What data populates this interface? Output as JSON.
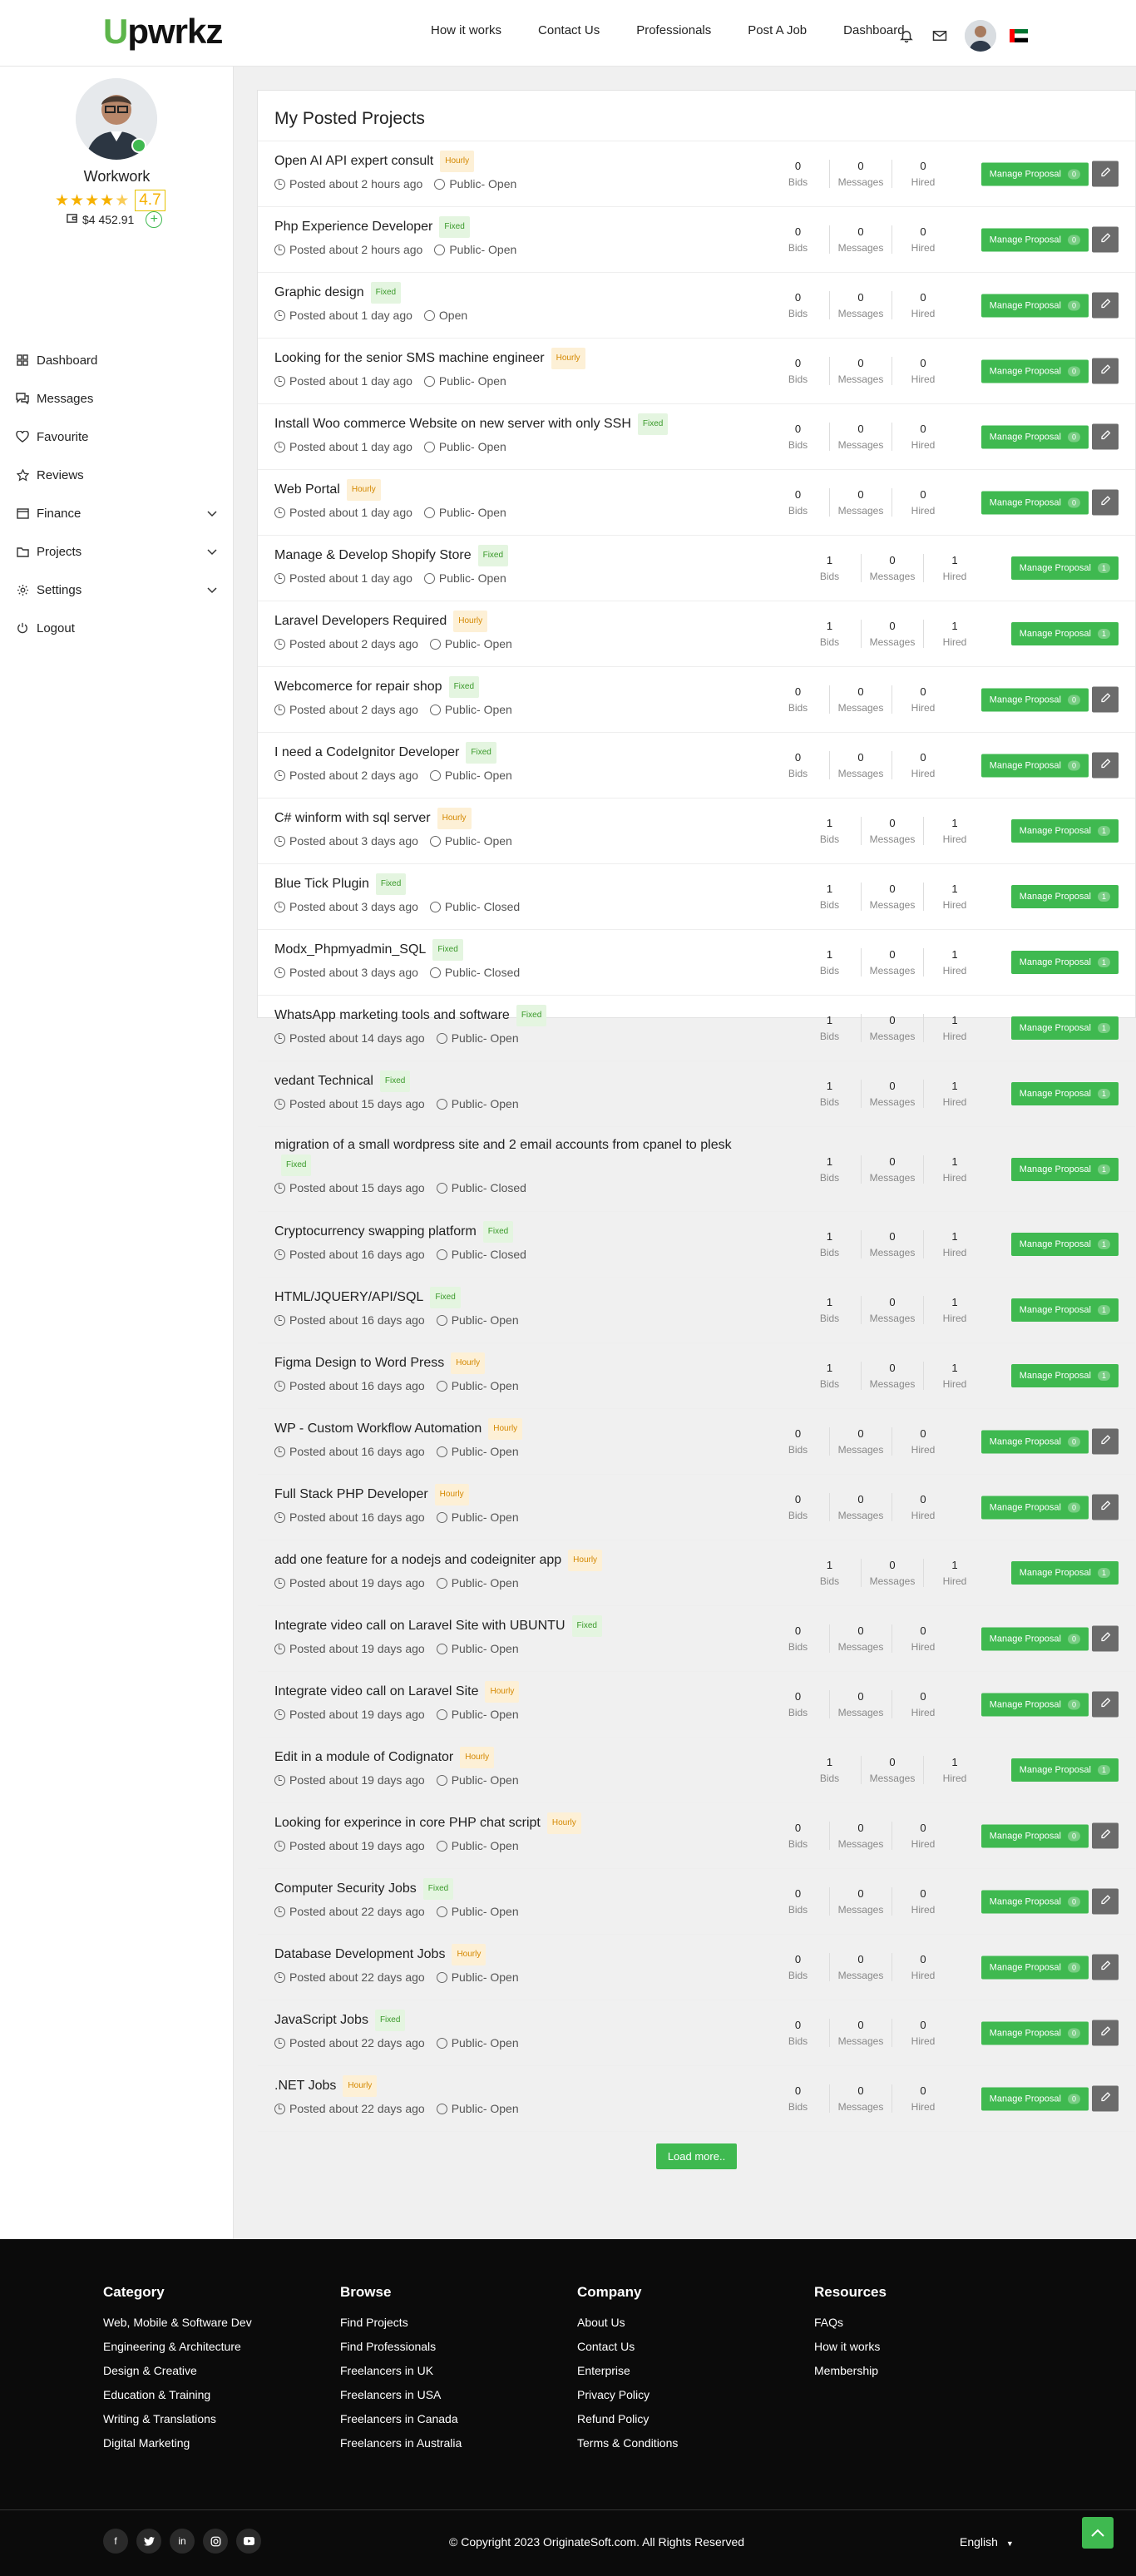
{
  "header": {
    "logo_u": "U",
    "logo_rest": "pwrkz",
    "nav": [
      "How it works",
      "Contact Us",
      "Professionals",
      "Post A Job",
      "Dashboard"
    ]
  },
  "profile": {
    "name": "Workwork",
    "rating": "4.7",
    "stars": 4.5,
    "balance": "$4 452.91"
  },
  "menu": [
    "Dashboard",
    "Messages",
    "Favourite",
    "Reviews",
    "Finance",
    "Projects",
    "Settings",
    "Logout"
  ],
  "card_title": "My Posted Projects",
  "labels": {
    "bids": "Bids",
    "messages": "Messages",
    "hired": "Hired",
    "manage": "Manage Proposal",
    "load_more": "Load more.."
  },
  "projects": [
    {
      "title": "Open AI API expert consult",
      "type": "Hourly",
      "posted": "Posted about 2 hours ago",
      "vis": "Public- Open",
      "bids": 0,
      "messages": 0,
      "hired": 0
    },
    {
      "title": "Php Experience Developer",
      "type": "Fixed",
      "posted": "Posted about 2 hours ago",
      "vis": "Public- Open",
      "bids": 0,
      "messages": 0,
      "hired": 0
    },
    {
      "title": "Graphic design",
      "type": "Fixed",
      "posted": "Posted about 1 day ago",
      "vis": "Open",
      "bids": 0,
      "messages": 0,
      "hired": 0
    },
    {
      "title": "Looking for the senior SMS machine engineer",
      "type": "Hourly",
      "posted": "Posted about 1 day ago",
      "vis": "Public- Open",
      "bids": 0,
      "messages": 0,
      "hired": 0
    },
    {
      "title": "Install Woo commerce Website on new server with only SSH",
      "type": "Fixed",
      "posted": "Posted about 1 day ago",
      "vis": "Public- Open",
      "bids": 0,
      "messages": 0,
      "hired": 0
    },
    {
      "title": "Web Portal",
      "type": "Hourly",
      "posted": "Posted about 1 day ago",
      "vis": "Public- Open",
      "bids": 0,
      "messages": 0,
      "hired": 0
    },
    {
      "title": "Manage & Develop Shopify Store",
      "type": "Fixed",
      "posted": "Posted about 1 day ago",
      "vis": "Public- Open",
      "bids": 1,
      "messages": 0,
      "hired": 1
    },
    {
      "title": "Laravel Developers Required",
      "type": "Hourly",
      "posted": "Posted about 2 days ago",
      "vis": "Public- Open",
      "bids": 1,
      "messages": 0,
      "hired": 1
    },
    {
      "title": "Webcomerce for repair shop",
      "type": "Fixed",
      "posted": "Posted about 2 days ago",
      "vis": "Public- Open",
      "bids": 0,
      "messages": 0,
      "hired": 0
    },
    {
      "title": "I need a CodeIgnitor Developer",
      "type": "Fixed",
      "posted": "Posted about 2 days ago",
      "vis": "Public- Open",
      "bids": 0,
      "messages": 0,
      "hired": 0
    },
    {
      "title": "C# winform with sql server",
      "type": "Hourly",
      "posted": "Posted about 3 days ago",
      "vis": "Public- Open",
      "bids": 1,
      "messages": 0,
      "hired": 1
    },
    {
      "title": "Blue Tick Plugin",
      "type": "Fixed",
      "posted": "Posted about 3 days ago",
      "vis": "Public- Closed",
      "bids": 1,
      "messages": 0,
      "hired": 1
    },
    {
      "title": "Modx_Phpmyadmin_SQL",
      "type": "Fixed",
      "posted": "Posted about 3 days ago",
      "vis": "Public- Closed",
      "bids": 1,
      "messages": 0,
      "hired": 1
    },
    {
      "title": "WhatsApp marketing tools and software",
      "type": "Fixed",
      "posted": "Posted about 14 days ago",
      "vis": "Public- Open",
      "bids": 1,
      "messages": 0,
      "hired": 1
    },
    {
      "title": "vedant Technical",
      "type": "Fixed",
      "posted": "Posted about 15 days ago",
      "vis": "Public- Open",
      "bids": 1,
      "messages": 0,
      "hired": 1
    },
    {
      "title": "migration of a small wordpress site and 2 email accounts from cpanel to plesk",
      "type": "Fixed",
      "posted": "Posted about 15 days ago",
      "vis": "Public- Closed",
      "bids": 1,
      "messages": 0,
      "hired": 1
    },
    {
      "title": "Cryptocurrency swapping platform",
      "type": "Fixed",
      "posted": "Posted about 16 days ago",
      "vis": "Public- Closed",
      "bids": 1,
      "messages": 0,
      "hired": 1
    },
    {
      "title": "HTML/JQUERY/API/SQL",
      "type": "Fixed",
      "posted": "Posted about 16 days ago",
      "vis": "Public- Open",
      "bids": 1,
      "messages": 0,
      "hired": 1
    },
    {
      "title": "Figma Design to Word Press",
      "type": "Hourly",
      "posted": "Posted about 16 days ago",
      "vis": "Public- Open",
      "bids": 1,
      "messages": 0,
      "hired": 1
    },
    {
      "title": "WP - Custom Workflow Automation",
      "type": "Hourly",
      "posted": "Posted about 16 days ago",
      "vis": "Public- Open",
      "bids": 0,
      "messages": 0,
      "hired": 0
    },
    {
      "title": "Full Stack PHP Developer",
      "type": "Hourly",
      "posted": "Posted about 16 days ago",
      "vis": "Public- Open",
      "bids": 0,
      "messages": 0,
      "hired": 0
    },
    {
      "title": "add one feature for a nodejs and codeigniter app",
      "type": "Hourly",
      "posted": "Posted about 19 days ago",
      "vis": "Public- Open",
      "bids": 1,
      "messages": 0,
      "hired": 1
    },
    {
      "title": "Integrate video call on Laravel Site with UBUNTU",
      "type": "Fixed",
      "posted": "Posted about 19 days ago",
      "vis": "Public- Open",
      "bids": 0,
      "messages": 0,
      "hired": 0
    },
    {
      "title": "Integrate video call on Laravel Site",
      "type": "Hourly",
      "posted": "Posted about 19 days ago",
      "vis": "Public- Open",
      "bids": 0,
      "messages": 0,
      "hired": 0
    },
    {
      "title": "Edit in a module of Codignator",
      "type": "Hourly",
      "posted": "Posted about 19 days ago",
      "vis": "Public- Open",
      "bids": 1,
      "messages": 0,
      "hired": 1
    },
    {
      "title": "Looking for experince in core PHP chat script",
      "type": "Hourly",
      "posted": "Posted about 19 days ago",
      "vis": "Public- Open",
      "bids": 0,
      "messages": 0,
      "hired": 0
    },
    {
      "title": "Computer Security Jobs",
      "type": "Fixed",
      "posted": "Posted about 22 days ago",
      "vis": "Public- Open",
      "bids": 0,
      "messages": 0,
      "hired": 0
    },
    {
      "title": "Database Development Jobs",
      "type": "Hourly",
      "posted": "Posted about 22 days ago",
      "vis": "Public- Open",
      "bids": 0,
      "messages": 0,
      "hired": 0
    },
    {
      "title": "JavaScript Jobs",
      "type": "Fixed",
      "posted": "Posted about 22 days ago",
      "vis": "Public- Open",
      "bids": 0,
      "messages": 0,
      "hired": 0
    },
    {
      "title": ".NET Jobs",
      "type": "Hourly",
      "posted": "Posted about 22 days ago",
      "vis": "Public- Open",
      "bids": 0,
      "messages": 0,
      "hired": 0
    }
  ],
  "footer": {
    "columns": [
      {
        "title": "Category",
        "links": [
          "Web, Mobile & Software Dev",
          "Engineering & Architecture",
          "Design & Creative",
          "Education & Training",
          "Writing & Translations",
          "Digital Marketing"
        ]
      },
      {
        "title": "Browse",
        "links": [
          "Find Projects",
          "Find Professionals",
          "Freelancers in UK",
          "Freelancers in USA",
          "Freelancers in Canada",
          "Freelancers in Australia"
        ]
      },
      {
        "title": "Company",
        "links": [
          "About Us",
          "Contact Us",
          "Enterprise",
          "Privacy Policy",
          "Refund Policy",
          "Terms & Conditions"
        ]
      },
      {
        "title": "Resources",
        "links": [
          "FAQs",
          "How it works",
          "Membership"
        ]
      }
    ],
    "copyright": "© Copyright 2023 OriginateSoft.com. All Rights Reserved",
    "language": "English"
  },
  "colors": {
    "accent": "#3fb950",
    "fixed_badge": "#e4f5e0",
    "hourly_badge": "#fdf0d6",
    "footer_bg": "#0b0b0b"
  }
}
